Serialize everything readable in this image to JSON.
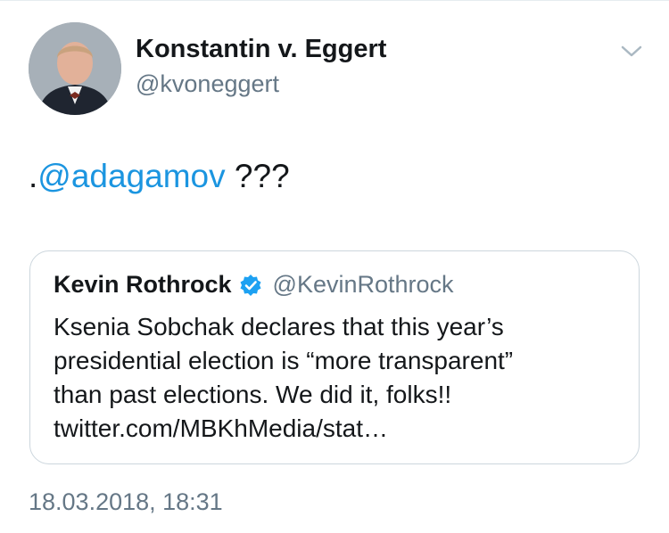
{
  "tweet": {
    "author": {
      "display_name": "Konstantin v. Eggert",
      "handle": "@kvoneggert",
      "avatar_icon": "user-photo-avatar"
    },
    "menu_icon": "chevron-down-icon",
    "text_prefix": ".",
    "mention": "@adagamov",
    "text_suffix": " ???",
    "quoted_tweet": {
      "author_name": "Kevin Rothrock",
      "verified_icon": "verified-badge-icon",
      "handle": "@KevinRothrock",
      "lines": [
        "Ksenia Sobchak declares that this year’s",
        "presidential election is “more transparent”",
        "than past elections. We did it, folks!!",
        "twitter.com/MBKhMedia/stat…"
      ]
    },
    "timestamp": "18.03.2018, 18:31"
  },
  "colors": {
    "link": "#1b95e0",
    "text": "#14171a",
    "secondary": "#657786",
    "border": "#ccd6dd",
    "verified": "#1da1f2"
  }
}
